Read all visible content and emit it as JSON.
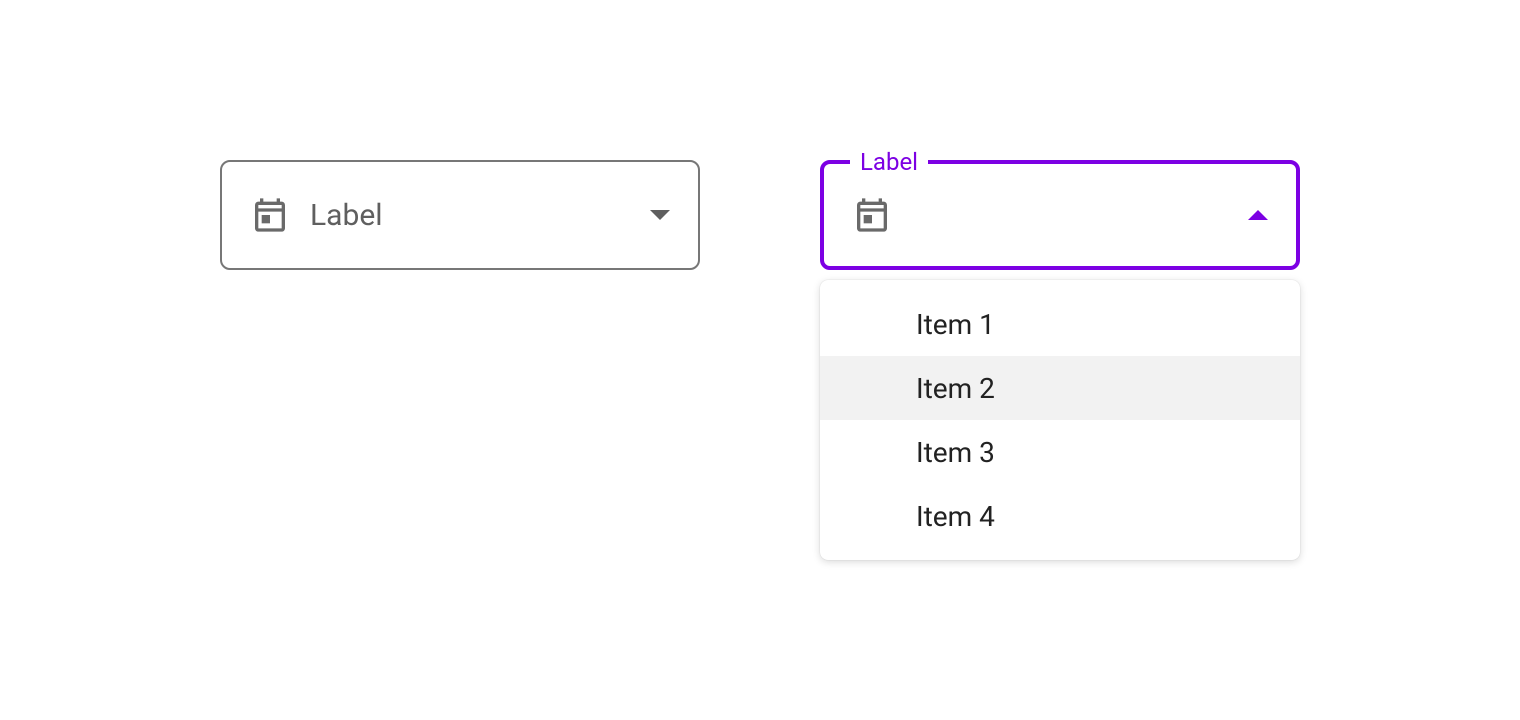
{
  "colors": {
    "accent": "#7c00e3",
    "border": "#777777",
    "text_muted": "#5f5f5f"
  },
  "select_closed": {
    "label": "Label",
    "icon": "calendar"
  },
  "select_open": {
    "label": "Label",
    "icon": "calendar",
    "items": [
      {
        "label": "Item 1",
        "highlighted": false
      },
      {
        "label": "Item 2",
        "highlighted": true
      },
      {
        "label": "Item 3",
        "highlighted": false
      },
      {
        "label": "Item 4",
        "highlighted": false
      }
    ]
  }
}
